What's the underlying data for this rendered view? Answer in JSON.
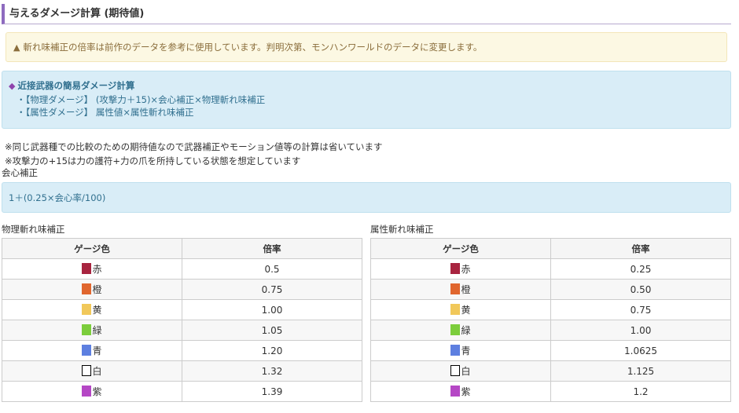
{
  "heading": "与えるダメージ計算 (期待値)",
  "warning": "斬れ味補正の倍率は前作のデータを参考に使用しています。判明次第、モンハンワールドのデータに変更します。",
  "info": {
    "title": "近接武器の簡易ダメージ計算",
    "items": [
      "・【物理ダメージ】 (攻撃力＋15)×会心補正×物理斬れ味補正",
      "・【属性ダメージ】 属性値×属性斬れ味補正"
    ]
  },
  "notes": [
    "※同じ武器種での比較のための期待値なので武器補正やモーション値等の計算は省いています",
    "※攻撃力の+15は力の護符+力の爪を所持している状態を想定しています"
  ],
  "kaishin_label": "会心補正",
  "kaishin_formula": "1＋(0.25×会心率/100)",
  "tables": {
    "physical": {
      "label": "物理斬れ味補正",
      "header": [
        "ゲージ色",
        "倍率"
      ],
      "rows": [
        {
          "color": "赤",
          "swatch": "#a8243f",
          "value": "0.5"
        },
        {
          "color": "橙",
          "swatch": "#e0662e",
          "value": "0.75"
        },
        {
          "color": "黄",
          "swatch": "#f1c85a",
          "value": "1.00"
        },
        {
          "color": "緑",
          "swatch": "#7ccd3c",
          "value": "1.05"
        },
        {
          "color": "青",
          "swatch": "#5d7fe0",
          "value": "1.20"
        },
        {
          "color": "白",
          "swatch": "#ffffff",
          "value": "1.32"
        },
        {
          "color": "紫",
          "swatch": "#b547c5",
          "value": "1.39"
        }
      ]
    },
    "element": {
      "label": "属性斬れ味補正",
      "header": [
        "ゲージ色",
        "倍率"
      ],
      "rows": [
        {
          "color": "赤",
          "swatch": "#a8243f",
          "value": "0.25"
        },
        {
          "color": "橙",
          "swatch": "#e0662e",
          "value": "0.50"
        },
        {
          "color": "黄",
          "swatch": "#f1c85a",
          "value": "0.75"
        },
        {
          "color": "緑",
          "swatch": "#7ccd3c",
          "value": "1.00"
        },
        {
          "color": "青",
          "swatch": "#5d7fe0",
          "value": "1.0625"
        },
        {
          "color": "白",
          "swatch": "#ffffff",
          "value": "1.125"
        },
        {
          "color": "紫",
          "swatch": "#b547c5",
          "value": "1.2"
        }
      ]
    }
  }
}
